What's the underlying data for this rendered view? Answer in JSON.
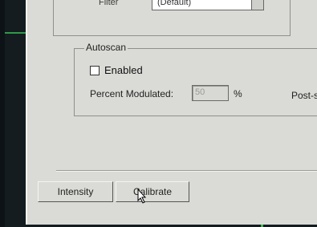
{
  "top_group": {
    "filter_label": "Filter",
    "filter_value": "(Default)"
  },
  "autoscan": {
    "title": "Autoscan",
    "enabled_label": "Enabled",
    "percent_label": "Percent Modulated:",
    "percent_value": "50",
    "percent_unit": "%",
    "post_scan_label": "Post-scan L"
  },
  "buttons": {
    "intensity": "Intensity",
    "calibrate": "Calibrate"
  },
  "colors": {
    "window_bg": "#dadad6",
    "monitor_bg": "#141c1f",
    "accent_green": "#3fb455"
  }
}
